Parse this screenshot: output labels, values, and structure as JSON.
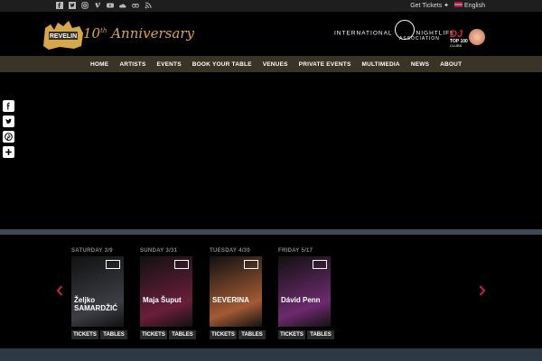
{
  "topbar": {
    "social_icons": [
      "facebook-icon",
      "twitter-icon",
      "instagram-icon",
      "vimeo-icon",
      "youtube-icon",
      "soundcloud-icon",
      "tripadvisor-icon",
      "rss-icon"
    ],
    "get_tickets": "Get Tickets",
    "language": "English"
  },
  "header": {
    "anniversary_num": "10",
    "anniversary_sup": "th",
    "anniversary_word": "Anniversary",
    "ina_left": "INTERNATIONAL",
    "ina_right": "NIGHTLIFE",
    "ina_sub": "ASSOCIATION",
    "dj_label": "DJ",
    "dj_top": "TOP 100",
    "dj_clubs": "CLUBS",
    "logo_label": "REVELIN"
  },
  "nav": {
    "items": [
      "HOME",
      "ARTISTS",
      "EVENTS",
      "BOOK YOUR TABLE",
      "VENUES",
      "PRIVATE EVENTS",
      "MULTIMEDIA",
      "NEWS",
      "ABOUT"
    ]
  },
  "share": [
    "facebook-icon",
    "twitter-icon",
    "pinterest-icon",
    "plus-icon"
  ],
  "events": [
    {
      "date": "SATURDAY 3/9",
      "name": "Željko SAMARDŽIĆ",
      "tickets": "TICKETS",
      "tables": "TABLES",
      "color": "#3b3e44"
    },
    {
      "date": "SUNDAY 3/31",
      "name": "Maja Šuput",
      "tickets": "TICKETS",
      "tables": "TABLES",
      "color": "#6a1e3a"
    },
    {
      "date": "TUESDAY 4/30",
      "name": "SEVERINA",
      "tickets": "TICKETS",
      "tables": "TABLES",
      "color": "#a35a33"
    },
    {
      "date": "FRIDAY 5/17",
      "name": "Dávid Penn",
      "tickets": "TICKETS",
      "tables": "TABLES",
      "color": "#6d2a6e"
    }
  ],
  "colors": {
    "accent": "#d7a84a",
    "nav_bg": "#3a3426",
    "arrow": "#c8254a"
  }
}
